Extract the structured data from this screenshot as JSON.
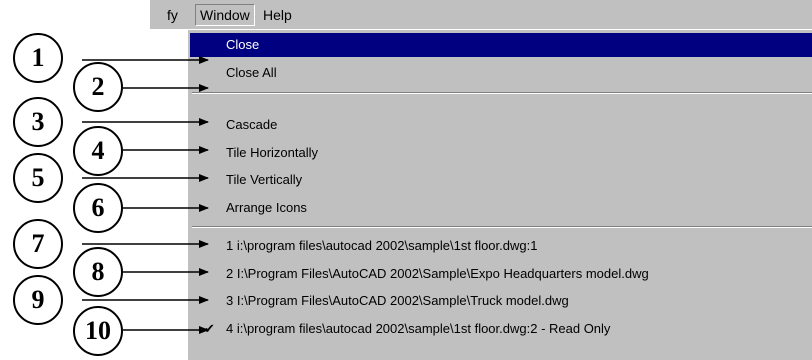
{
  "menubar": {
    "items": [
      {
        "label": "fy"
      },
      {
        "label": "Window"
      },
      {
        "label": "Help"
      }
    ]
  },
  "window_menu": {
    "items": [
      {
        "label": "Close",
        "selected": true
      },
      {
        "label": "Close All"
      },
      {
        "label": "Cascade"
      },
      {
        "label": "Tile Horizontally"
      },
      {
        "label": "Tile Vertically"
      },
      {
        "label": "Arrange Icons"
      },
      {
        "label": "1 i:\\program files\\autocad 2002\\sample\\1st floor.dwg:1"
      },
      {
        "label": "2 I:\\Program Files\\AutoCAD 2002\\Sample\\Expo Headquarters model.dwg"
      },
      {
        "label": "3 I:\\Program Files\\AutoCAD 2002\\Sample\\Truck model.dwg"
      },
      {
        "label": "4 i:\\program files\\autocad 2002\\sample\\1st floor.dwg:2 - Read Only",
        "checked": true
      }
    ]
  },
  "callouts": [
    "1",
    "2",
    "3",
    "4",
    "5",
    "6",
    "7",
    "8",
    "9",
    "10"
  ],
  "colors": {
    "selection": "#000080",
    "menu_bg": "#c0c0c0"
  }
}
